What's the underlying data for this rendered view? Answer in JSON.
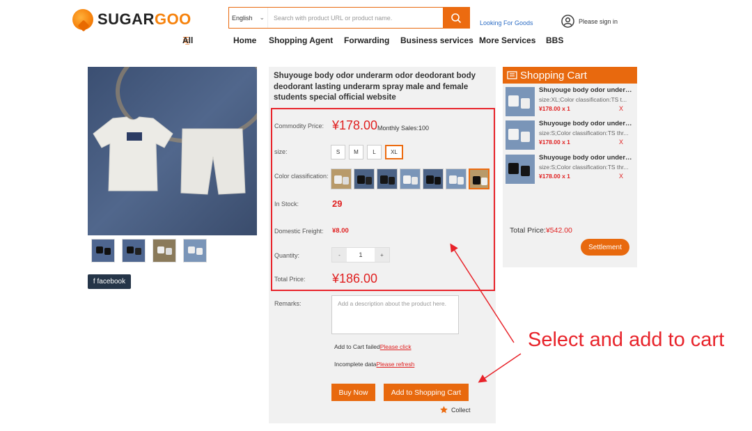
{
  "header": {
    "logo_text_a": "SUGAR",
    "logo_text_b": "GOO",
    "language": "English",
    "search_placeholder": "Search with product URL or product name.",
    "looking_for_goods": "Looking For Goods",
    "sign_in": "Please sign in"
  },
  "nav": {
    "all": "All",
    "items": [
      "Home",
      "Shopping Agent",
      "Forwarding",
      "Business services",
      "More Services",
      "BBS"
    ]
  },
  "product": {
    "title": "Shuyouge body odor underarm odor deodorant body deodorant lasting underarm spray male and female students special official website",
    "facebook": "f facebook",
    "labels": {
      "price": "Commodity Price:",
      "size": "size:",
      "color": "Color classification:",
      "stock": "In Stock:",
      "freight": "Domestic Freight:",
      "quantity": "Quantity:",
      "total": "Total Price:",
      "remarks": "Remarks:"
    },
    "price": "¥178.00",
    "monthly_sales": "Monthly Sales:100",
    "sizes": [
      "S",
      "M",
      "L",
      "XL"
    ],
    "selected_size": "XL",
    "stock": "29",
    "freight": "¥8.00",
    "qty_minus": "-",
    "qty_value": "1",
    "qty_plus": "+",
    "total": "¥186.00",
    "remarks_placeholder": "Add a description about the product here.",
    "add_failed": "Add to Cart failed",
    "please_click": "Please click",
    "incomplete": "Incomplete data",
    "please_refresh": "Please refresh",
    "buy_now": "Buy Now",
    "add_to_cart": "Add to Shopping Cart",
    "collect": "Collect"
  },
  "cart": {
    "title": "Shopping Cart",
    "items": [
      {
        "name": "Shuyouge body odor underarm odor deodorant",
        "spec": "size:XL;Color classification:TS t...",
        "price": "¥178.00 x 1",
        "remove": "X"
      },
      {
        "name": "Shuyouge body odor underarm odor deodorant",
        "spec": "size:S;Color classification:TS thr...",
        "price": "¥178.00 x 1",
        "remove": "X"
      },
      {
        "name": "Shuyouge body odor underarm odor deodorant",
        "spec": "size:S;Color classification:TS thr...",
        "price": "¥178.00 x 1",
        "remove": "X"
      }
    ],
    "total_label": "Total Price:",
    "total_value": "¥542.00",
    "settlement": "Settlement"
  },
  "annotation": "Select and add to cart",
  "colors": {
    "accent": "#e8690e",
    "price_red": "#e02020",
    "annot_red": "#e8232a"
  }
}
